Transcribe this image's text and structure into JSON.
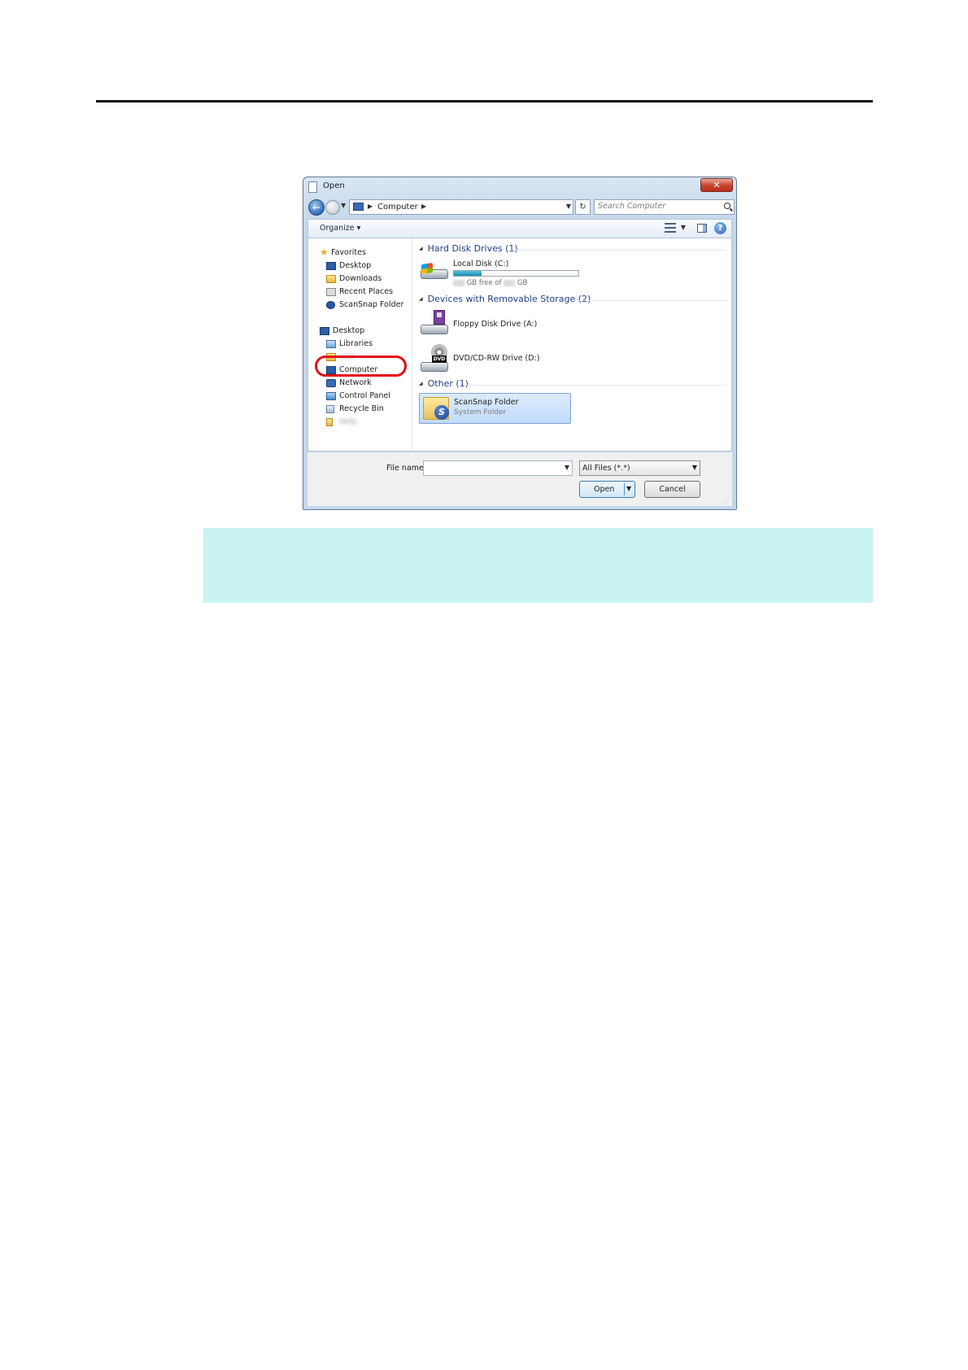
{
  "dialog": {
    "title": "Open",
    "close_glyph": "✕",
    "nav": {
      "back_glyph": "←",
      "address_path": "Computer",
      "search_placeholder": "Search Computer",
      "refresh_glyph": "↻"
    },
    "toolbar": {
      "organize_label": "Organize ▾",
      "help_glyph": "?"
    },
    "nav_pane": {
      "favorites_label": "Favorites",
      "favorites": [
        "Desktop",
        "Downloads",
        "Recent Places",
        "ScanSnap Folder"
      ],
      "desktop_label": "Desktop",
      "libraries_label": "Libraries",
      "user_folder_label": "user",
      "computer_label": "Computer",
      "network_label": "Network",
      "control_panel_label": "Control Panel",
      "recycle_bin_label": "Recycle Bin",
      "extra_folder_label": "Help",
      "highlighted_item": "Computer",
      "highlight_color": "#e30b16"
    },
    "groups": {
      "hard_disk_title": "Hard Disk Drives (1)",
      "removable_title": "Devices with Removable Storage (2)",
      "other_title": "Other (1)"
    },
    "drives": {
      "local_disk_name": "Local Disk (C:)",
      "local_disk_free_text": "GB free of",
      "local_disk_total_text": "GB",
      "local_disk_used_fraction": 0.22,
      "floppy_name": "Floppy Disk Drive (A:)",
      "dvd_name": "DVD/CD-RW Drive (D:)",
      "dvd_badge": "DVD"
    },
    "other_item": {
      "name": "ScanSnap Folder",
      "type": "System Folder",
      "badge": "S"
    },
    "footer": {
      "file_name_label": "File name:",
      "file_name_value": "",
      "filter_value": "All Files (*.*)",
      "open_label": "Open",
      "cancel_label": "Cancel"
    }
  },
  "colors": {
    "note_background": "#c9f3f2",
    "group_header": "#1e3f8a",
    "selection": "#c1dcfa"
  }
}
